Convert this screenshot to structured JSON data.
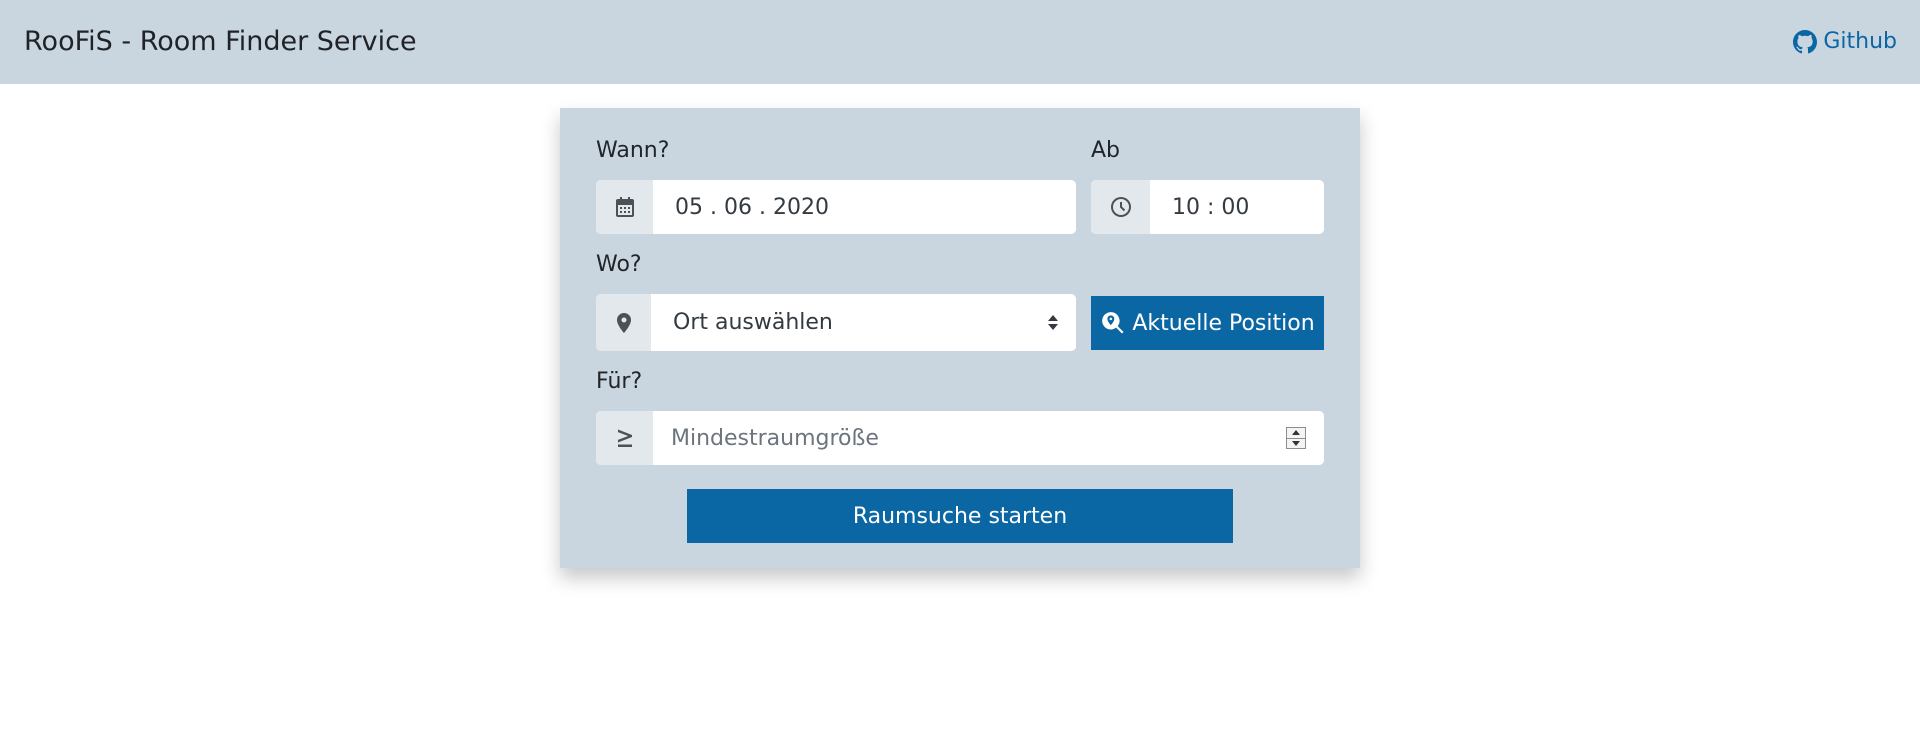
{
  "header": {
    "title": "RooFiS - Room Finder Service",
    "github_label": "Github"
  },
  "form": {
    "when": {
      "label": "Wann?",
      "date_value": "05 . 06 . 2020",
      "icon": "calendar-icon"
    },
    "from": {
      "label": "Ab",
      "time_value": "10 : 00",
      "icon": "clock-icon"
    },
    "where": {
      "label": "Wo?",
      "select_value": "Ort auswählen",
      "icon": "map-marker-icon"
    },
    "locate_button_label": "Aktuelle Position",
    "for": {
      "label": "Für?",
      "placeholder": "Mindestraumgröße",
      "icon": "greater-equal-icon"
    },
    "submit_label": "Raumsuche starten"
  },
  "colors": {
    "panel_background": "#cad6df",
    "accent": "#0b67a3",
    "addon_background": "#e3e8ec"
  }
}
